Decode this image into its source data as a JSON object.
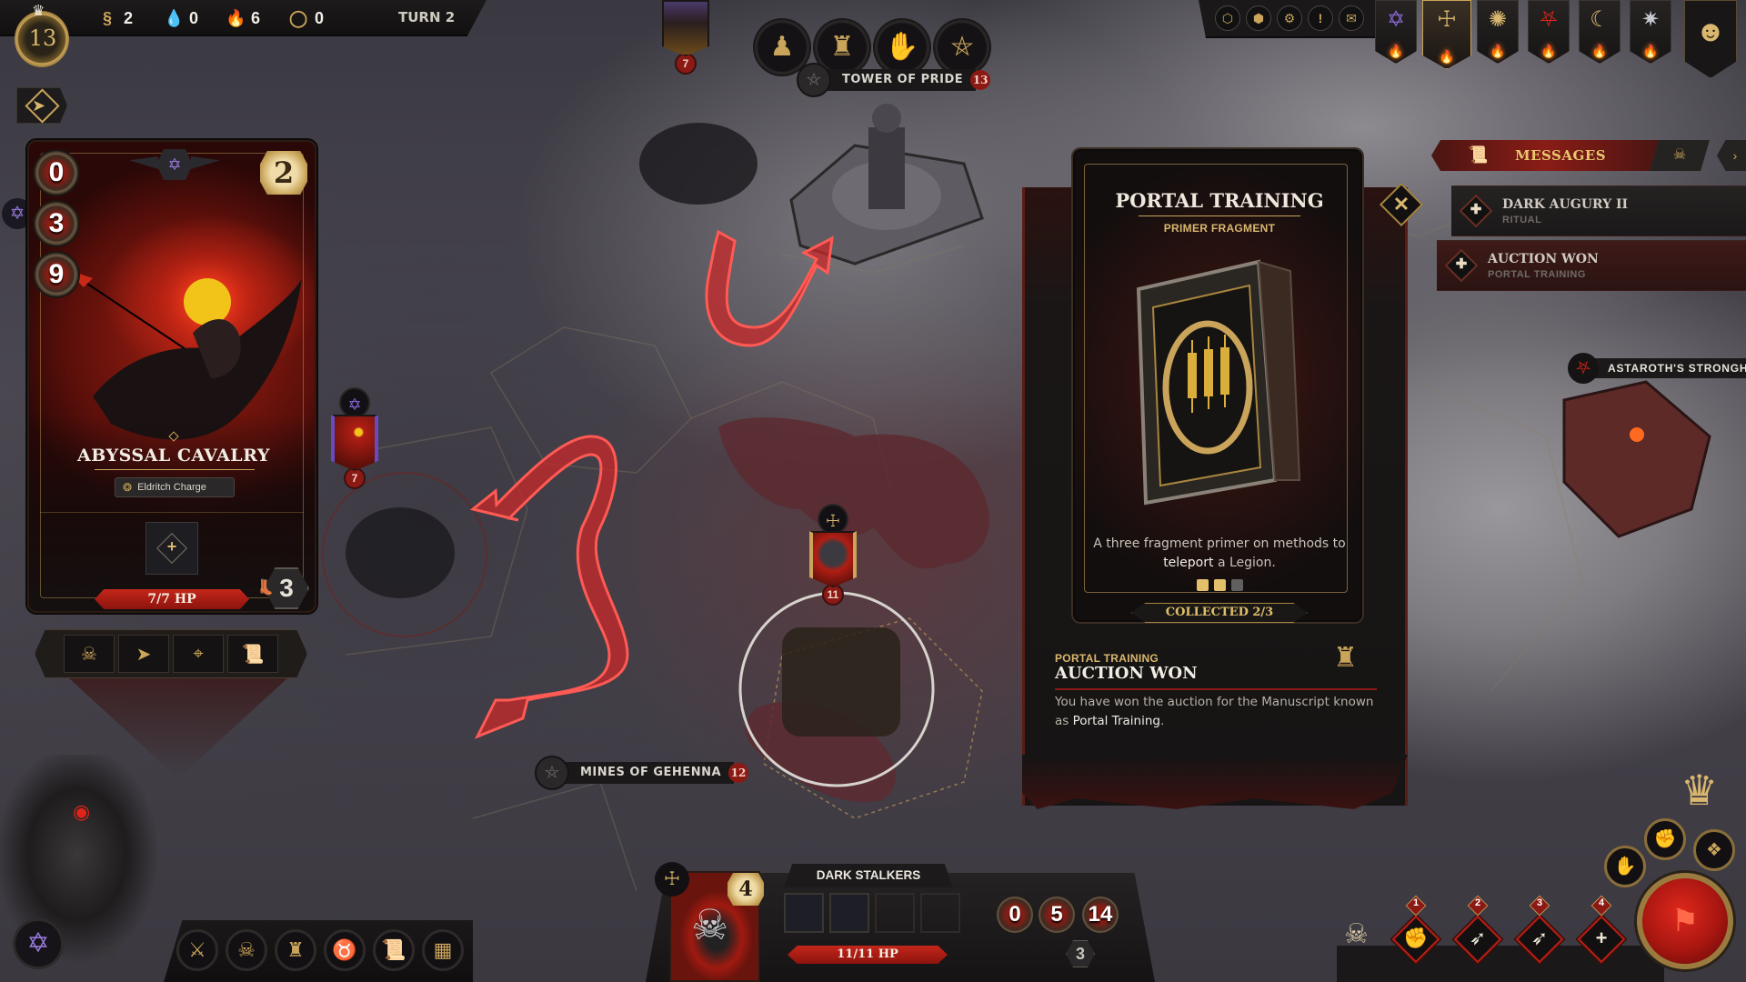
{
  "top_bar": {
    "level": "13",
    "resources": [
      {
        "name": "souls",
        "icon": "soul-icon",
        "glyph": "§",
        "value": "2"
      },
      {
        "name": "blood",
        "icon": "blood-drop-icon",
        "glyph": "💧",
        "value": "0"
      },
      {
        "name": "fire",
        "icon": "fire-icon",
        "glyph": "🔥",
        "value": "6"
      },
      {
        "name": "void",
        "icon": "void-ring-icon",
        "glyph": "◯",
        "value": "0"
      }
    ],
    "turn": "TURN 2"
  },
  "system_buttons": [
    {
      "name": "hex-overlay-button",
      "glyph": "⬡"
    },
    {
      "name": "hex-outline-button",
      "glyph": "⬢"
    },
    {
      "name": "settings-button",
      "glyph": "⚙"
    },
    {
      "name": "alerts-button",
      "glyph": "!"
    },
    {
      "name": "codex-button",
      "glyph": "✉"
    }
  ],
  "faction_banners": [
    {
      "name": "violet-sigil",
      "glyph": "✡",
      "color": "#8a6ad8",
      "active": false
    },
    {
      "name": "gold-cross-sigil",
      "glyph": "☩",
      "color": "#d9b76e",
      "active": true
    },
    {
      "name": "gold-star-sigil",
      "glyph": "✺",
      "color": "#d9b76e",
      "active": false
    },
    {
      "name": "red-sigil",
      "glyph": "⛧",
      "color": "#e0241a",
      "active": false
    },
    {
      "name": "gold-moon-sigil",
      "glyph": "☾",
      "color": "#d9b76e",
      "active": false
    },
    {
      "name": "silver-sigil",
      "glyph": "✷",
      "color": "#c8c8d0",
      "active": false
    }
  ],
  "flame_glyph": "🔥",
  "unit_card": {
    "name": "ABYSSAL CAVALRY",
    "tier": "2",
    "stats": [
      {
        "name": "armor",
        "value": "0"
      },
      {
        "name": "attack",
        "value": "3"
      },
      {
        "name": "health",
        "value": "9"
      }
    ],
    "ability": "Eldritch Charge",
    "hp": "7/7 HP",
    "hp_fraction": 1.0,
    "movement": "3",
    "actions": [
      {
        "name": "demon-face",
        "glyph": "☠"
      },
      {
        "name": "advance",
        "glyph": "➤"
      },
      {
        "name": "target",
        "glyph": "⌖"
      },
      {
        "name": "tome",
        "glyph": "📜"
      }
    ],
    "add_glyph": "+"
  },
  "map": {
    "locations": [
      {
        "name": "TOWER OF PRIDE",
        "count": "13"
      },
      {
        "name": "MINES OF GEHENNA",
        "count": "12"
      },
      {
        "name": "ASTAROTH'S STRONGHOLD"
      }
    ],
    "tokens": [
      {
        "name": "enemy-legion-top",
        "count": "7",
        "emblem_color": "#8a6ad8"
      },
      {
        "name": "abyssal-cavalry-token",
        "count": "7",
        "emblem_color": "#8a6ad8"
      },
      {
        "name": "dark-stalkers-token",
        "count": "11",
        "emblem_color": "#d9b76e"
      }
    ],
    "tower_actions": [
      {
        "name": "hooded-figure",
        "glyph": "♟"
      },
      {
        "name": "throne",
        "glyph": "♜"
      },
      {
        "name": "eye-hand",
        "glyph": "✋"
      },
      {
        "name": "pentagram",
        "glyph": "⛤"
      }
    ]
  },
  "messages": {
    "header": "MESSAGES",
    "items": [
      {
        "title": "DARK AUGURY II",
        "subtitle": "RITUAL",
        "active": false
      },
      {
        "title": "AUCTION WON",
        "subtitle": "PORTAL TRAINING",
        "active": true
      }
    ]
  },
  "reward": {
    "card_title": "PORTAL TRAINING",
    "card_subtitle": "PRIMER FRAGMENT",
    "description_pre": "A three fragment primer on methods to ",
    "description_bold": "teleport",
    "description_post": " a Legion.",
    "collected": 2,
    "total": 3,
    "collected_label": "COLLECTED 2/3",
    "notice_subtitle": "PORTAL TRAINING",
    "notice_title": "AUCTION WON",
    "notice_body_pre": "You have won the auction for the Manuscript known as ",
    "notice_body_bold": "Portal Training",
    "notice_body_post": ".",
    "close_glyph": "✕"
  },
  "legion": {
    "name": "DARK STALKERS",
    "tier": "4",
    "hp": "11/11 HP",
    "hp_fraction": 1.0,
    "stats": [
      "0",
      "5",
      "14"
    ],
    "movement": "3",
    "slots_filled": 2,
    "slots_total": 4
  },
  "bottom_left_buttons": [
    {
      "name": "sword-banner",
      "glyph": "⚔"
    },
    {
      "name": "demon-skull",
      "glyph": "☠"
    },
    {
      "name": "tower",
      "glyph": "♜"
    },
    {
      "name": "horns",
      "glyph": "♉"
    },
    {
      "name": "scroll",
      "glyph": "📜"
    },
    {
      "name": "gate",
      "glyph": "▦"
    }
  ],
  "spells": [
    {
      "key": "1",
      "glyph": "✊"
    },
    {
      "key": "2",
      "glyph": "➶"
    },
    {
      "key": "3",
      "glyph": "➶"
    },
    {
      "key": "4",
      "glyph": "+"
    }
  ],
  "end_turn_glyph": "⚑",
  "side_round_buttons": [
    {
      "name": "summon",
      "glyph": "✋"
    },
    {
      "name": "fist",
      "glyph": "✊"
    },
    {
      "name": "rune",
      "glyph": "❖"
    }
  ]
}
